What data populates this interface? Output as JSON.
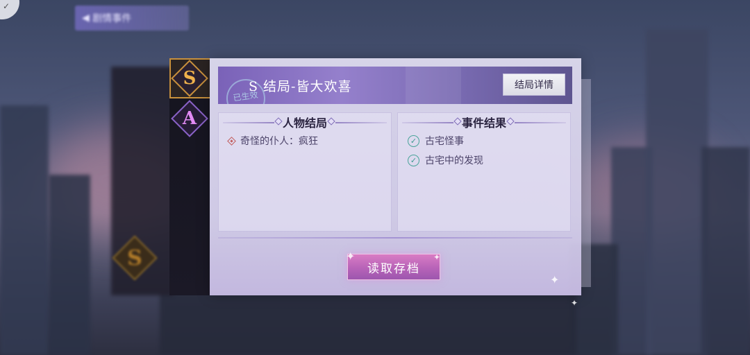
{
  "background": {
    "back_button_label": "剧情事件"
  },
  "grades": [
    {
      "letter": "S",
      "selected": true
    },
    {
      "letter": "A",
      "selected": false
    }
  ],
  "dim_grade_letter": "S",
  "ending": {
    "title": "S 结局-皆大欢喜",
    "stamp_text": "已生效",
    "details_button": "结局详情"
  },
  "character_outcomes": {
    "title": "人物结局",
    "items": [
      {
        "text": "奇怪的仆人：疯狂"
      }
    ]
  },
  "event_results": {
    "title": "事件结果",
    "items": [
      {
        "text": "古宅怪事",
        "completed": true
      },
      {
        "text": "古宅中的发现",
        "completed": true
      }
    ]
  },
  "load_save_button": "读取存档",
  "colors": {
    "grade_s": "#f0b24c",
    "grade_a": "#e38bf5",
    "banner": "#8a72c4",
    "load_button": "#c06ab8",
    "check": "#4aa49a",
    "bullet": "#c25a5a"
  }
}
